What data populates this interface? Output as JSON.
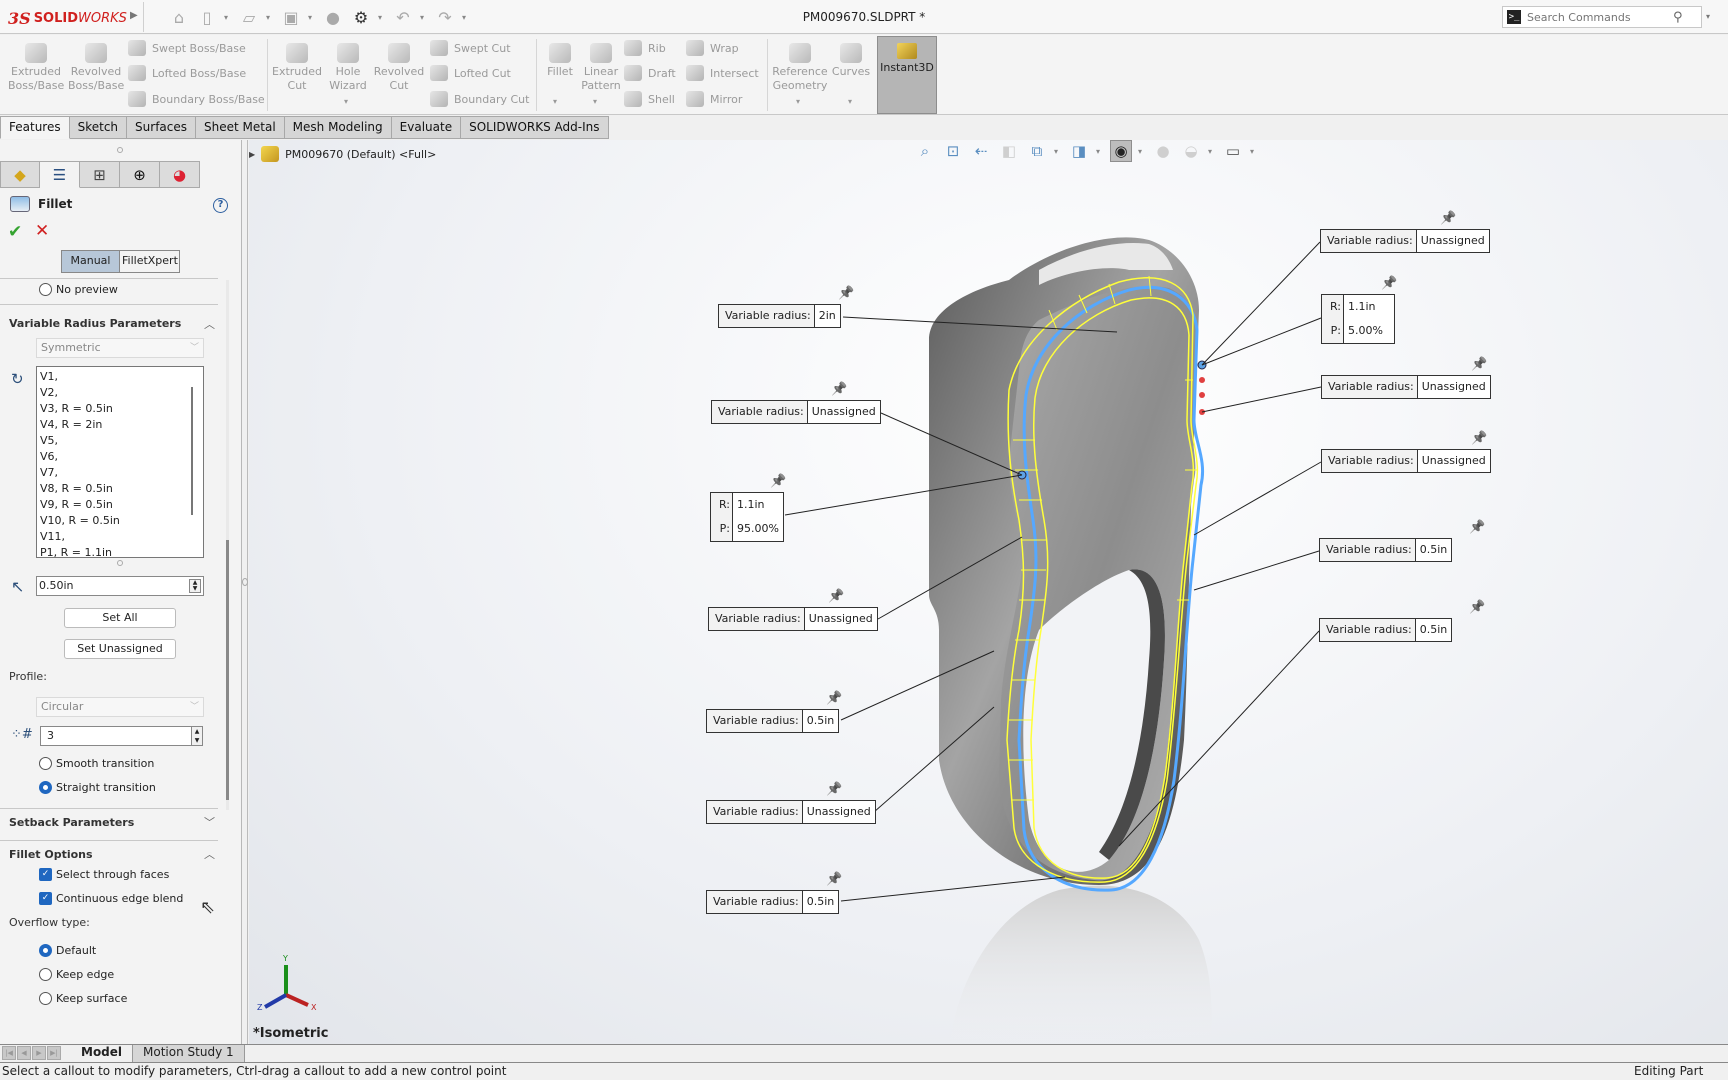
{
  "app": {
    "brand_ds": "3S",
    "brand_solid": "SOLID",
    "brand_works": "WORKS",
    "doc_title": "PM009670.SLDPRT *",
    "search_placeholder": "Search Commands"
  },
  "quick_access": [
    "home-icon",
    "new-document-icon",
    "open-icon",
    "save-icon",
    "print-icon",
    "options-gear-icon",
    "undo-icon",
    "redo-icon"
  ],
  "command_manager": {
    "extruded_boss": "Extruded Boss/Base",
    "revolved_boss": "Revolved Boss/Base",
    "swept_boss": "Swept Boss/Base",
    "lofted_boss": "Lofted Boss/Base",
    "boundary_boss": "Boundary Boss/Base",
    "extruded_cut": "Extruded Cut",
    "hole_wizard": "Hole Wizard",
    "revolved_cut": "Revolved Cut",
    "swept_cut": "Swept Cut",
    "lofted_cut": "Lofted Cut",
    "boundary_cut": "Boundary Cut",
    "fillet": "Fillet",
    "linear_pattern": "Linear Pattern",
    "rib": "Rib",
    "draft": "Draft",
    "shell": "Shell",
    "wrap": "Wrap",
    "intersect": "Intersect",
    "mirror": "Mirror",
    "reference_geometry": "Reference Geometry",
    "curves": "Curves",
    "instant3d": "Instant3D"
  },
  "tabs": [
    {
      "label": "Features",
      "active": true
    },
    {
      "label": "Sketch"
    },
    {
      "label": "Surfaces"
    },
    {
      "label": "Sheet Metal"
    },
    {
      "label": "Mesh Modeling"
    },
    {
      "label": "Evaluate"
    },
    {
      "label": "SOLIDWORKS Add-Ins"
    }
  ],
  "property_manager": {
    "title": "Fillet",
    "help": "?",
    "ok": "✔",
    "cancel": "✕",
    "mode_manual": "Manual",
    "mode_filletxpert": "FilletXpert",
    "no_preview": "No preview",
    "variable_radius_header": "Variable Radius Parameters",
    "symmetric": "Symmetric",
    "vertex_list": [
      "V1,",
      "V2,",
      "V3, R = 0.5in",
      "V4, R = 2in",
      "V5,",
      "V6,",
      "V7,",
      "V8, R = 0.5in",
      "V9, R = 0.5in",
      "V10, R = 0.5in",
      "V11,",
      "P1, R = 1.1in"
    ],
    "radius_value": "0.50in",
    "set_all": "Set All",
    "set_unassigned": "Set Unassigned",
    "profile_label": "Profile:",
    "profile_value": "Circular",
    "instances_value": "3",
    "smooth_transition": "Smooth transition",
    "straight_transition": "Straight transition",
    "transition_selected": "straight",
    "setback_header": "Setback Parameters",
    "fillet_options_header": "Fillet Options",
    "select_through_faces": "Select through faces",
    "select_through_faces_checked": true,
    "continuous_edge_blend": "Continuous edge blend",
    "continuous_edge_blend_checked": true,
    "overflow_label": "Overflow type:",
    "overflow_default": "Default",
    "overflow_keep_edge": "Keep edge",
    "overflow_keep_surface": "Keep surface",
    "overflow_selected": "default"
  },
  "viewport": {
    "tree_root": "PM009670 (Default) <Full>",
    "view_name": "*Isometric",
    "triad": {
      "x": "X",
      "y": "Y",
      "z": "Z"
    },
    "callouts": [
      {
        "id": "c1",
        "key": "Variable radius:",
        "value": "2in"
      },
      {
        "id": "c2",
        "key": "Variable radius:",
        "value": "Unassigned"
      },
      {
        "id": "c4",
        "key": "Variable radius:",
        "value": "Unassigned"
      },
      {
        "id": "c5",
        "key": "Variable radius:",
        "value": "0.5in"
      },
      {
        "id": "c6",
        "key": "Variable radius:",
        "value": "Unassigned"
      },
      {
        "id": "c7",
        "key": "Variable radius:",
        "value": "0.5in"
      },
      {
        "id": "c8",
        "key": "Variable radius:",
        "value": "Unassigned"
      },
      {
        "id": "c10",
        "key": "Variable radius:",
        "value": "Unassigned"
      },
      {
        "id": "c11",
        "key": "Variable radius:",
        "value": "Unassigned"
      },
      {
        "id": "c12",
        "key": "Variable radius:",
        "value": "0.5in"
      },
      {
        "id": "c13",
        "key": "Variable radius:",
        "value": "0.5in"
      }
    ],
    "point_callouts": [
      {
        "id": "p1",
        "r_key": "R:",
        "r_value": "1.1in",
        "p_key": "P:",
        "p_value": "95.00%"
      },
      {
        "id": "p2",
        "r_key": "R:",
        "r_value": "1.1in",
        "p_key": "P:",
        "p_value": "5.00%"
      }
    ]
  },
  "bottom_tabs": [
    {
      "label": "Model",
      "active": true
    },
    {
      "label": "Motion Study 1"
    }
  ],
  "status": {
    "message": "Select a callout to modify parameters, Ctrl-drag a callout to add a new control point",
    "mode": "Editing Part"
  }
}
